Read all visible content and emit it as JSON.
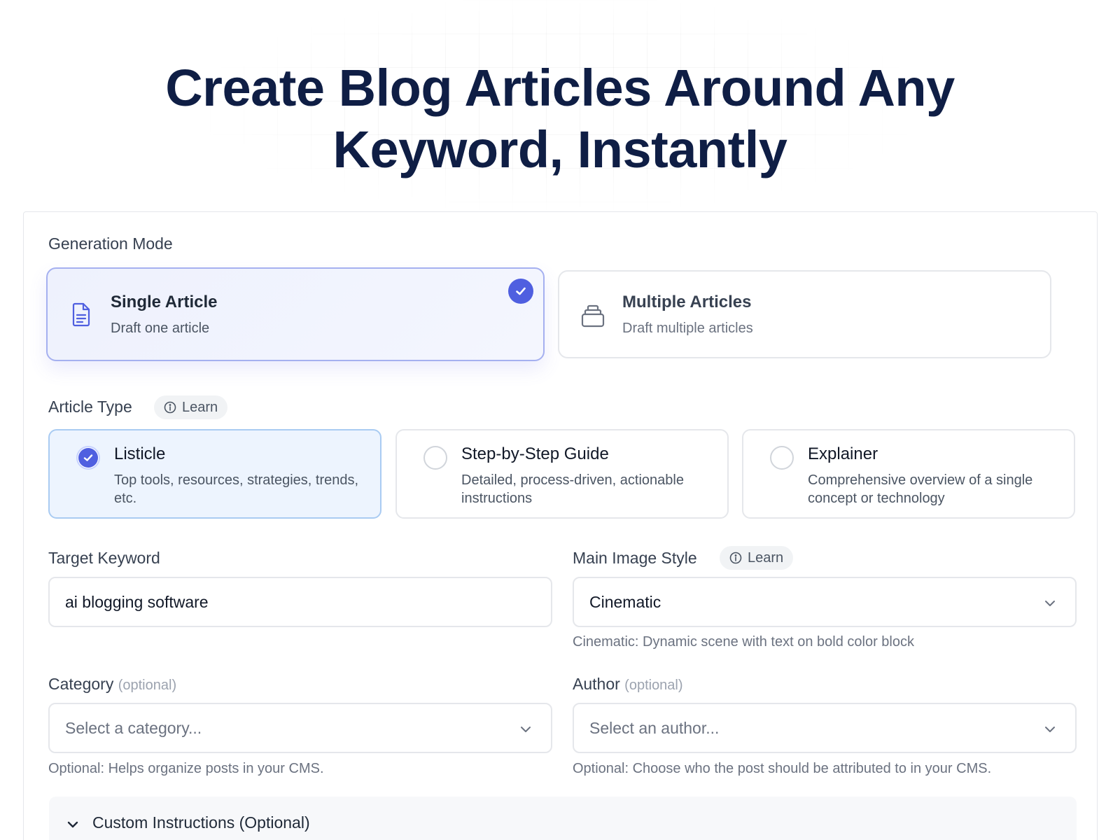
{
  "hero": {
    "title_line1": "Create Blog Articles Around Any",
    "title_line2": "Keyword, Instantly"
  },
  "generation_mode": {
    "label": "Generation Mode",
    "options": [
      {
        "title": "Single Article",
        "subtitle": "Draft one article",
        "icon": "document-icon",
        "selected": true
      },
      {
        "title": "Multiple Articles",
        "subtitle": "Draft multiple articles",
        "icon": "stack-icon",
        "selected": false
      }
    ]
  },
  "article_type": {
    "label": "Article Type",
    "learn_label": "Learn",
    "options": [
      {
        "title": "Listicle",
        "desc": "Top tools, resources, strategies, trends, etc.",
        "selected": true
      },
      {
        "title": "Step-by-Step Guide",
        "desc": "Detailed, process-driven, actionable instructions",
        "selected": false
      },
      {
        "title": "Explainer",
        "desc": "Comprehensive overview of a single concept or technology",
        "selected": false
      }
    ]
  },
  "target_keyword": {
    "label": "Target Keyword",
    "value": "ai blogging software"
  },
  "main_image_style": {
    "label": "Main Image Style",
    "learn_label": "Learn",
    "value": "Cinematic",
    "help": "Cinematic: Dynamic scene with text on bold color block"
  },
  "category": {
    "label": "Category",
    "optional_tag": "(optional)",
    "placeholder": "Select a category...",
    "help": "Optional: Helps organize posts in your CMS."
  },
  "author": {
    "label": "Author",
    "optional_tag": "(optional)",
    "placeholder": "Select an author...",
    "help": "Optional: Choose who the post should be attributed to in your CMS."
  },
  "custom_instructions": {
    "label": "Custom Instructions (Optional)"
  },
  "colors": {
    "accent": "#4f5fe0",
    "title": "#0f1e45",
    "selected_bg": "#eef1fd",
    "selected_type_bg": "#edf4fe"
  }
}
